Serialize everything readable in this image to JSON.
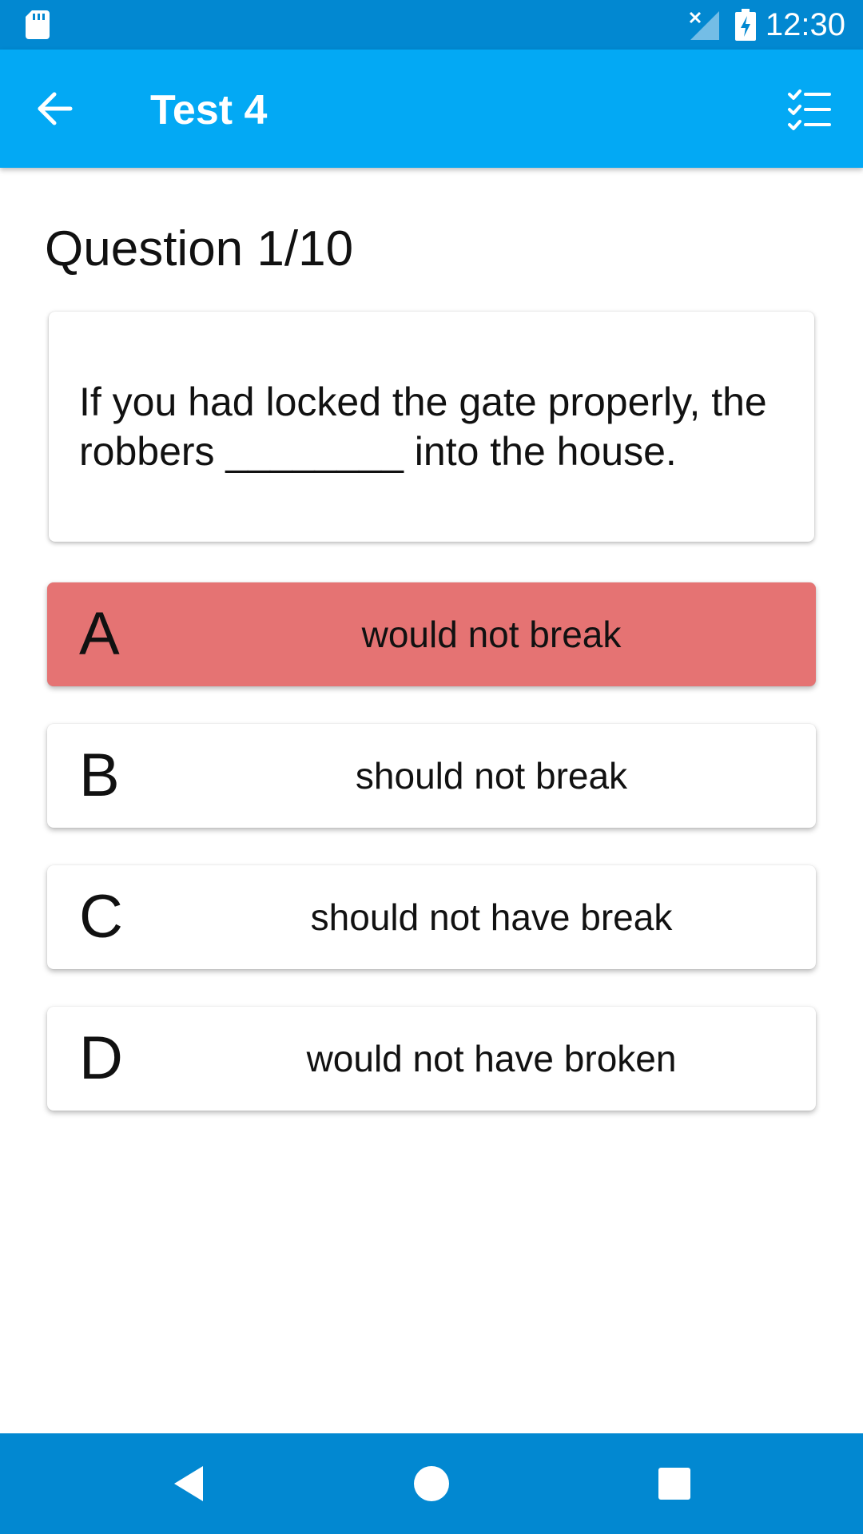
{
  "status_bar": {
    "time": "12:30",
    "icons": [
      "sd-card-icon",
      "signal-off-icon",
      "battery-charging-icon"
    ]
  },
  "app_bar": {
    "title": "Test 4",
    "back_icon": "arrow-back-icon",
    "list_icon": "checklist-icon"
  },
  "question": {
    "heading": "Question 1/10",
    "text": "If you had locked the gate properly, the robbers ________ into the house."
  },
  "options": [
    {
      "letter": "A",
      "text": "would not break",
      "selected": true
    },
    {
      "letter": "B",
      "text": "should not break",
      "selected": false
    },
    {
      "letter": "C",
      "text": "should not have break",
      "selected": false
    },
    {
      "letter": "D",
      "text": "would not have broken",
      "selected": false
    }
  ],
  "nav_bar": {
    "icons": [
      "nav-back-icon",
      "nav-home-icon",
      "nav-recents-icon"
    ]
  },
  "colors": {
    "status_bar": "#0288d1",
    "app_bar": "#03a9f4",
    "selected_option": "#e57373",
    "nav_bar": "#0288d1"
  }
}
